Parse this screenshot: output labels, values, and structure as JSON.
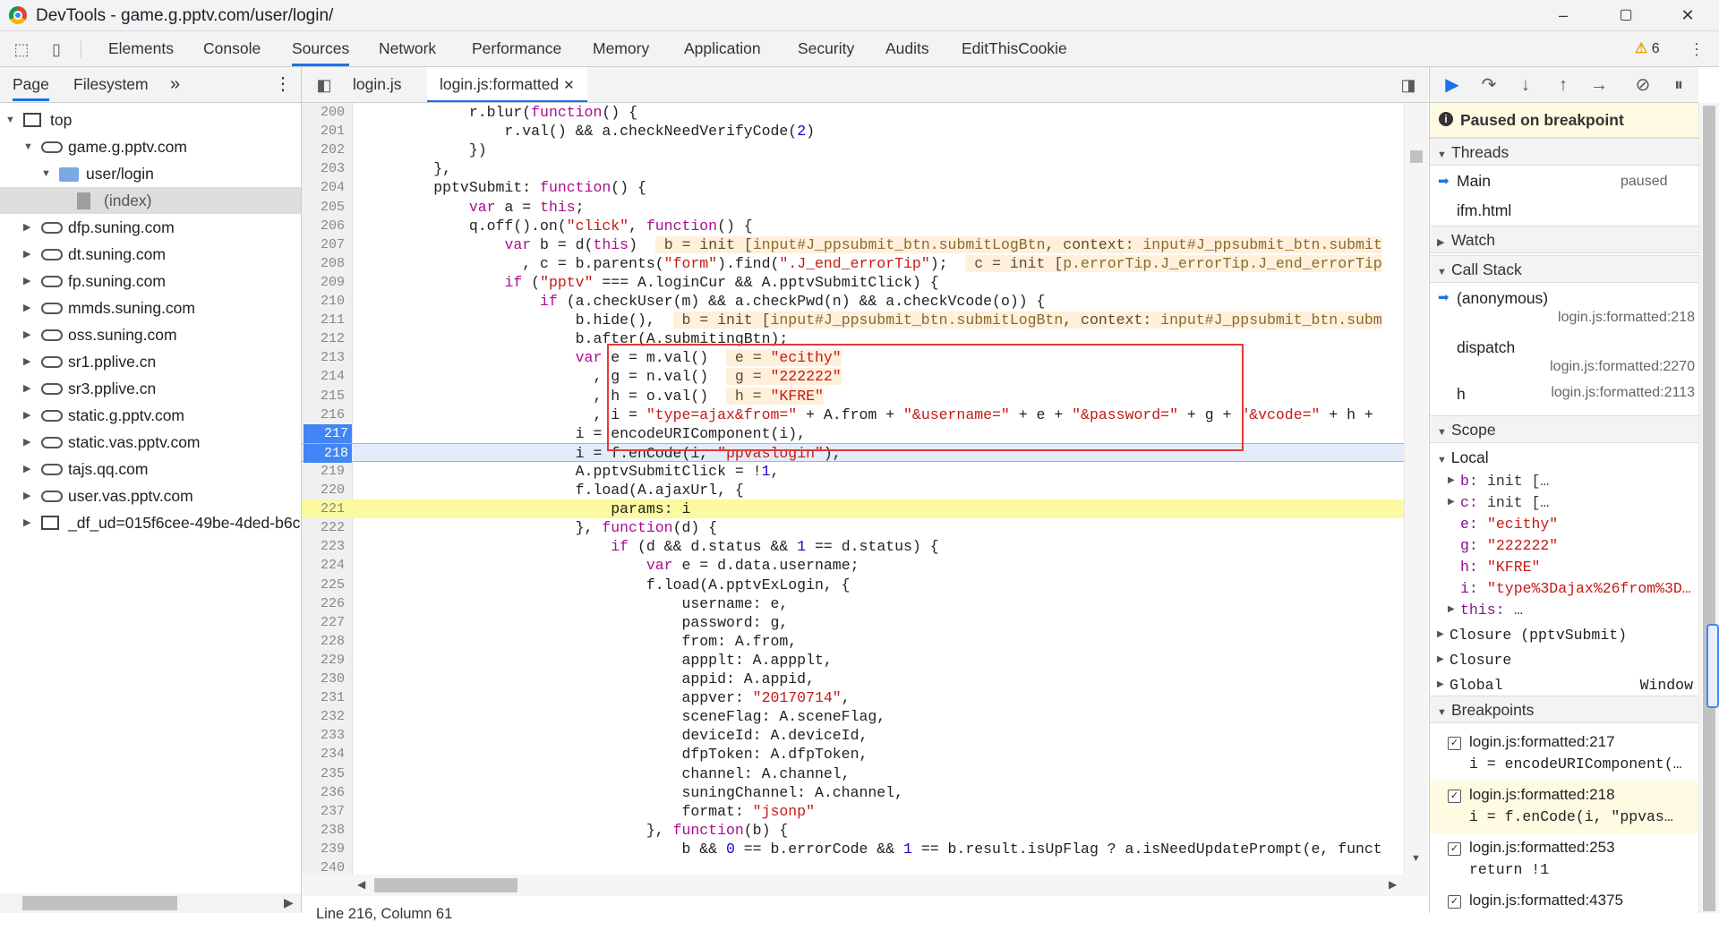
{
  "window": {
    "title": "DevTools - game.g.pptv.com/user/login/",
    "min": "–",
    "max": "▢",
    "close": "✕"
  },
  "main_tabs": [
    "Elements",
    "Console",
    "Sources",
    "Network",
    "Performance",
    "Memory",
    "Application",
    "Security",
    "Audits",
    "EditThisCookie"
  ],
  "active_tab": "Sources",
  "warnings_count": "6",
  "navigator": {
    "tabs": [
      "Page",
      "Filesystem"
    ],
    "more": "»",
    "items": [
      {
        "label": "top",
        "type": "frame",
        "indent": 0,
        "expanded": true
      },
      {
        "label": "game.g.pptv.com",
        "type": "cloud",
        "indent": 1,
        "expanded": true
      },
      {
        "label": "user/login",
        "type": "folder",
        "indent": 2,
        "expanded": true
      },
      {
        "label": "(index)",
        "type": "file",
        "indent": 3,
        "selected": true
      },
      {
        "label": "dfp.suning.com",
        "type": "cloud",
        "indent": 1
      },
      {
        "label": "dt.suning.com",
        "type": "cloud",
        "indent": 1
      },
      {
        "label": "fp.suning.com",
        "type": "cloud",
        "indent": 1
      },
      {
        "label": "mmds.suning.com",
        "type": "cloud",
        "indent": 1
      },
      {
        "label": "oss.suning.com",
        "type": "cloud",
        "indent": 1
      },
      {
        "label": "sr1.pplive.cn",
        "type": "cloud",
        "indent": 1
      },
      {
        "label": "sr3.pplive.cn",
        "type": "cloud",
        "indent": 1
      },
      {
        "label": "static.g.pptv.com",
        "type": "cloud",
        "indent": 1
      },
      {
        "label": "static.vas.pptv.com",
        "type": "cloud",
        "indent": 1
      },
      {
        "label": "tajs.qq.com",
        "type": "cloud",
        "indent": 1
      },
      {
        "label": "user.vas.pptv.com",
        "type": "cloud",
        "indent": 1
      },
      {
        "label": "_df_ud=015f6cee-49be-4ded-b6c",
        "type": "frame",
        "indent": 1
      }
    ]
  },
  "editor": {
    "tabs": [
      {
        "label": "login.js",
        "active": false
      },
      {
        "label": "login.js:formatted",
        "active": true,
        "close": "✕"
      }
    ],
    "status": "Line 216, Column 61"
  },
  "code_lines": [
    {
      "n": "200",
      "html": "            r.blur(<span class='k'>function</span>() {"
    },
    {
      "n": "201",
      "html": "                r.val() &amp;&amp; a.checkNeedVerifyCode(<span class='p'>2</span>)"
    },
    {
      "n": "202",
      "html": "            })"
    },
    {
      "n": "203",
      "html": "        },"
    },
    {
      "n": "204",
      "html": "        pptvSubmit: <span class='k'>function</span>() {"
    },
    {
      "n": "205",
      "html": "            <span class='k'>var</span> a = <span class='k'>this</span>;"
    },
    {
      "n": "206",
      "html": "            q.off().on(<span class='s'>\"click\"</span>, <span class='k'>function</span>() {"
    },
    {
      "n": "207",
      "html": "                <span class='k'>var</span> b = d(<span class='k'>this</span>)  <span class='inl'> b = init [<span class='p'>input#J_ppsubmit_btn.submitLogBtn</span>, context: <span class='p'>input#J_ppsubmit_btn.submit</span></span>"
    },
    {
      "n": "208",
      "html": "                  , c = b.parents(<span class='s'>\"form\"</span>).find(<span class='s'>\".J_end_errorTip\"</span>);  <span class='inl'> c = init [<span class='p'>p.errorTip.J_errorTip.J_end_errorTip</span></span>"
    },
    {
      "n": "209",
      "html": "                <span class='k'>if</span> (<span class='s'>\"pptv\"</span> === A.loginCur &amp;&amp; A.pptvSubmitClick) {"
    },
    {
      "n": "210",
      "html": "                    <span class='k'>if</span> (a.checkUser(m) &amp;&amp; a.checkPwd(n) &amp;&amp; a.checkVcode(o)) {"
    },
    {
      "n": "211",
      "html": "                        b.hide(),  <span class='inl'> b = init [<span class='p'>input#J_ppsubmit_btn.submitLogBtn</span>, context: <span class='p'>input#J_ppsubmit_btn.subm</span></span>"
    },
    {
      "n": "212",
      "html": "                        b.after(A.submitingBtn);"
    },
    {
      "n": "213",
      "html": "                        <span class='k'>var</span> e = m.val()  <span class='inl'> e = <span class='s'>\"ecithy\"</span></span>"
    },
    {
      "n": "214",
      "html": "                          , g = n.val()  <span class='inl'> g = <span class='s'>\"222222\"</span></span>"
    },
    {
      "n": "215",
      "html": "                          , h = o.val()  <span class='inl'> h = <span class='s'>\"KFRE\"</span></span>"
    },
    {
      "n": "216",
      "html": "                          , i = <span class='s'>\"type=ajax&amp;from=\"</span> + A.from + <span class='s'>\"&amp;username=\"</span> + e + <span class='s'>\"&amp;password=\"</span> + g + <span class='s'>\"&amp;vcode=\"</span> + h +"
    },
    {
      "n": "217",
      "html": "                        i = encodeURIComponent(i),",
      "bp": true
    },
    {
      "n": "218",
      "html": "                        i = f.enCode(i, <span class='s'>\"ppvaslogin\"</span>),",
      "bp": true,
      "cur": true
    },
    {
      "n": "219",
      "html": "                        A.pptvSubmitClick = !<span class='p'>1</span>,"
    },
    {
      "n": "220",
      "html": "                        f.load(A.ajaxUrl, {"
    },
    {
      "n": "221",
      "html": "                            params: i",
      "exec": true
    },
    {
      "n": "222",
      "html": "                        }, <span class='k'>function</span>(d) {"
    },
    {
      "n": "223",
      "html": "                            <span class='k'>if</span> (d &amp;&amp; d.status &amp;&amp; <span class='p'>1</span> == d.status) {"
    },
    {
      "n": "224",
      "html": "                                <span class='k'>var</span> e = d.data.username;"
    },
    {
      "n": "225",
      "html": "                                f.load(A.pptvExLogin, {"
    },
    {
      "n": "226",
      "html": "                                    username: e,"
    },
    {
      "n": "227",
      "html": "                                    password: g,"
    },
    {
      "n": "228",
      "html": "                                    from: A.from,"
    },
    {
      "n": "229",
      "html": "                                    appplt: A.appplt,"
    },
    {
      "n": "230",
      "html": "                                    appid: A.appid,"
    },
    {
      "n": "231",
      "html": "                                    appver: <span class='s'>\"20170714\"</span>,"
    },
    {
      "n": "232",
      "html": "                                    sceneFlag: A.sceneFlag,"
    },
    {
      "n": "233",
      "html": "                                    deviceId: A.deviceId,"
    },
    {
      "n": "234",
      "html": "                                    dfpToken: A.dfpToken,"
    },
    {
      "n": "235",
      "html": "                                    channel: A.channel,"
    },
    {
      "n": "236",
      "html": "                                    suningChannel: A.channel,"
    },
    {
      "n": "237",
      "html": "                                    format: <span class='s'>\"jsonp\"</span>"
    },
    {
      "n": "238",
      "html": "                                }, <span class='k'>function</span>(b) {"
    },
    {
      "n": "239",
      "html": "                                    b &amp;&amp; <span class='p'>0</span> == b.errorCode &amp;&amp; <span class='p'>1</span> == b.result.isUpFlag ? a.isNeedUpdatePrompt(e, funct"
    },
    {
      "n": "240",
      "html": ""
    }
  ],
  "debugger": {
    "paused_text": "Paused on breakpoint",
    "threads_title": "Threads",
    "threads": [
      {
        "name": "Main",
        "state": "paused",
        "active": true
      },
      {
        "name": "ifm.html",
        "state": ""
      }
    ],
    "watch_title": "Watch",
    "callstack_title": "Call Stack",
    "callstack": [
      {
        "fn": "(anonymous)",
        "loc": "login.js:formatted:218",
        "active": true
      },
      {
        "fn": "dispatch",
        "loc": "login.js:formatted:2270"
      },
      {
        "fn": "h",
        "loc": "login.js:formatted:2113"
      }
    ],
    "scope_title": "Scope",
    "local_title": "Local",
    "locals": [
      {
        "name": "b:",
        "value": "init […",
        "expand": true
      },
      {
        "name": "c:",
        "value": "init […",
        "expand": true
      },
      {
        "name": "e:",
        "value": "\"ecithy\""
      },
      {
        "name": "g:",
        "value": "\"222222\""
      },
      {
        "name": "h:",
        "value": "\"KFRE\""
      },
      {
        "name": "i:",
        "value": "\"type%3Dajax%26from%3D…"
      },
      {
        "name": "this:",
        "value": "…",
        "expand": true
      }
    ],
    "closures": [
      {
        "name": "Closure (pptvSubmit)",
        "value": ""
      },
      {
        "name": "Closure",
        "value": ""
      },
      {
        "name": "Global",
        "value": "Window"
      }
    ],
    "breakpoints_title": "Breakpoints",
    "breakpoints": [
      {
        "loc": "login.js:formatted:217",
        "code": "i = encodeURIComponent(…",
        "active": false
      },
      {
        "loc": "login.js:formatted:218",
        "code": "i = f.enCode(i, \"ppvas…",
        "active": true
      },
      {
        "loc": "login.js:formatted:253",
        "code": "return !1",
        "active": false
      },
      {
        "loc": "login.js:formatted:4375",
        "code": "",
        "active": false
      }
    ]
  }
}
